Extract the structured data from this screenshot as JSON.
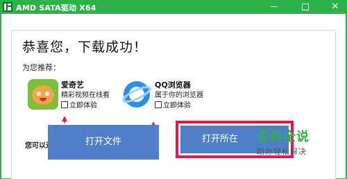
{
  "window": {
    "title": "AMD SATA驱动 X64"
  },
  "headline": "恭喜您，下载成功！",
  "recommend_label": "为您推荐：",
  "apps": [
    {
      "name": "爱奇艺",
      "desc": "精彩视频在线看",
      "try_label": "立即体验",
      "icon": "iqiyi-icon"
    },
    {
      "name": "QQ浏览器",
      "desc": "属于你的浏览器",
      "try_label": "立即体验",
      "icon": "qq-browser-icon"
    }
  ],
  "ops_label": "您可以进行以下操作：",
  "buttons": {
    "open_file": "打开文件",
    "open_folder": "打开所在"
  },
  "watermark": {
    "title": "百科全说",
    "subtitle": "助你轻松解决"
  },
  "colors": {
    "titlebar": "#2db24a",
    "button": "#4f7fc9",
    "highlight": "#e8164a"
  }
}
